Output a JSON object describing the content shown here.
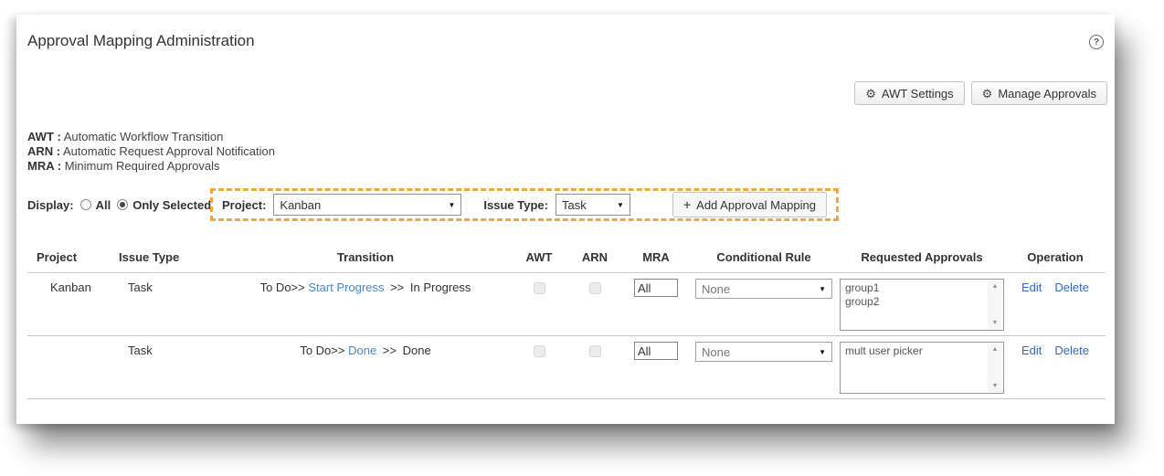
{
  "page": {
    "title": "Approval Mapping Administration",
    "help_icon": "?"
  },
  "icons": {
    "gear": "⚙",
    "dropdown_arrow": "▼",
    "plus": "+",
    "scroll_up": "▲",
    "scroll_down": "▼"
  },
  "toolbar": {
    "buttons": [
      {
        "label": "AWT Settings",
        "icon": "gear-icon"
      },
      {
        "label": "Manage Approvals",
        "icon": "gear-icon"
      }
    ]
  },
  "legend": {
    "items": [
      {
        "abbr": "AWT :",
        "desc": "Automatic Workflow Transition"
      },
      {
        "abbr": "ARN :",
        "desc": "Automatic Request Approval Notification"
      },
      {
        "abbr": "MRA :",
        "desc": "Minimum Required Approvals"
      }
    ]
  },
  "controls": {
    "display_label": "Display:",
    "options": [
      {
        "label": "All",
        "selected": false
      },
      {
        "label": "Only Selected",
        "selected": true
      }
    ],
    "project_label": "Project:",
    "project_value": "Kanban",
    "issue_type_label": "Issue Type:",
    "issue_type_value": "Task",
    "add_button_label": "Add Approval Mapping",
    "highlight_border_color": "#f0a63d"
  },
  "table": {
    "headers": {
      "project": "Project",
      "issue_type": "Issue Type",
      "transition": "Transition",
      "awt": "AWT",
      "arn": "ARN",
      "mra": "MRA",
      "conditional_rule": "Conditional Rule",
      "requested_approvals": "Requested Approvals",
      "operation": "Operation"
    },
    "rows": [
      {
        "project": "Kanban",
        "issue_type": "Task",
        "transition": {
          "from": "To Do>>",
          "action": "Start Progress",
          "arrow": ">>",
          "to": "In Progress"
        },
        "awt_checked": false,
        "arn_checked": false,
        "mra": "All",
        "conditional_rule": "None",
        "requested_approvals": "group1\ngroup2",
        "edit_label": "Edit",
        "delete_label": "Delete"
      },
      {
        "project": "",
        "issue_type": "Task",
        "transition": {
          "from": "To Do>>",
          "action": "Done",
          "arrow": ">>",
          "to": "Done"
        },
        "awt_checked": false,
        "arn_checked": false,
        "mra": "All",
        "conditional_rule": "None",
        "requested_approvals": "mult user picker",
        "edit_label": "Edit",
        "delete_label": "Delete"
      }
    ]
  },
  "colors": {
    "link_transition": "#4a86c6",
    "link_operation": "#3467c8",
    "highlight_dashed": "#f0a63d"
  }
}
